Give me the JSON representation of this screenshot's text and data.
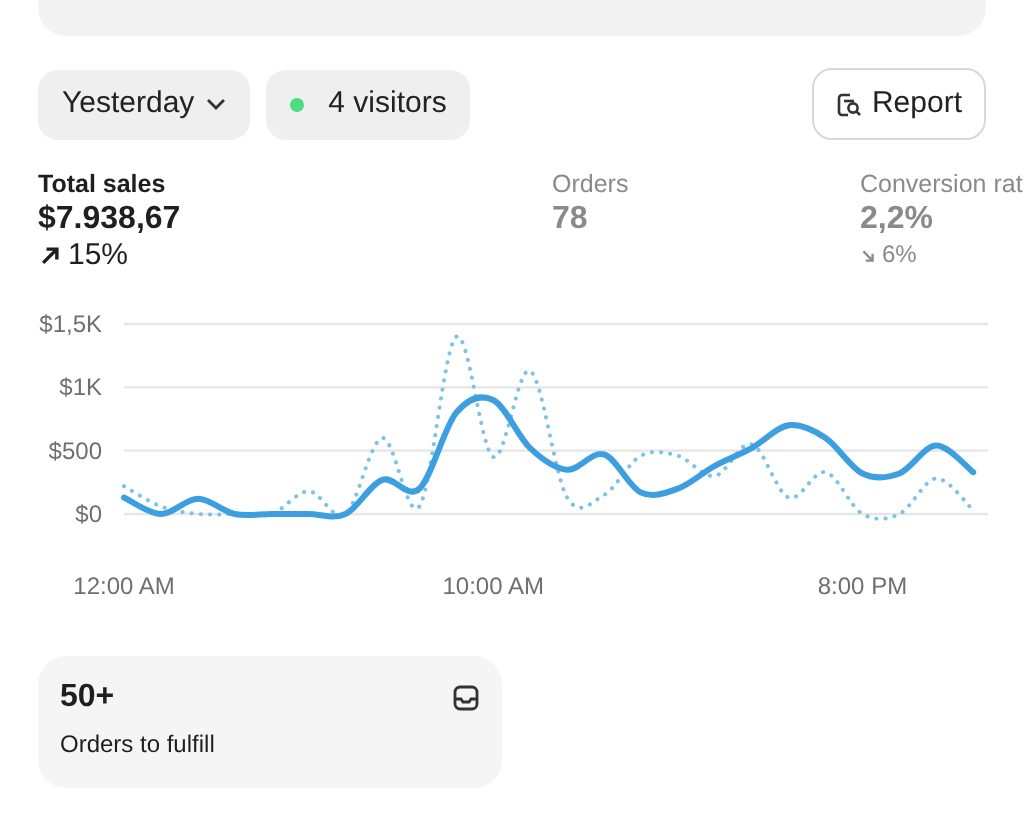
{
  "filters": {
    "date_range": "Yesterday",
    "visitors": "4 visitors",
    "report_button": "Report"
  },
  "metrics": [
    {
      "label": "Total sales",
      "value": "$7.938,67",
      "selected": true,
      "trend": {
        "kind": "up",
        "text": "15%"
      }
    },
    {
      "label": "Orders",
      "value": "78",
      "selected": false
    },
    {
      "label": "Conversion rat",
      "value": "2,2%",
      "selected": false,
      "trend": {
        "kind": "down",
        "text": "6%"
      }
    }
  ],
  "chart_data": {
    "type": "line",
    "x": [
      0,
      1,
      2,
      3,
      4,
      5,
      6,
      7,
      8,
      9,
      10,
      11,
      12,
      13,
      14,
      15,
      16,
      17,
      18,
      19,
      20,
      21,
      22,
      23
    ],
    "xlim": [
      0,
      23.4
    ],
    "ylim": [
      0,
      1500
    ],
    "yticks": [
      {
        "value": 0,
        "label": "$0"
      },
      {
        "value": 500,
        "label": "$500"
      },
      {
        "value": 1000,
        "label": "$1K"
      },
      {
        "value": 1500,
        "label": "$1,5K"
      }
    ],
    "xticks": [
      {
        "value": 0,
        "label": "12:00 AM"
      },
      {
        "value": 10,
        "label": "10:00 AM"
      },
      {
        "value": 20,
        "label": "8:00 PM"
      }
    ],
    "series": [
      {
        "color": "#3d9fe0",
        "line_style": "solid",
        "values": [
          130,
          0,
          120,
          0,
          0,
          0,
          0,
          270,
          200,
          800,
          900,
          520,
          350,
          470,
          170,
          200,
          380,
          520,
          700,
          600,
          320,
          320,
          540,
          330
        ]
      },
      {
        "color": "#7ec2e8",
        "line_style": "dotted",
        "values": [
          220,
          60,
          0,
          0,
          0,
          180,
          0,
          600,
          60,
          1400,
          450,
          1130,
          130,
          150,
          460,
          460,
          300,
          550,
          130,
          330,
          0,
          0,
          280,
          30
        ]
      }
    ]
  },
  "fulfill_card": {
    "count": "50+",
    "label": "Orders to fulfill"
  }
}
